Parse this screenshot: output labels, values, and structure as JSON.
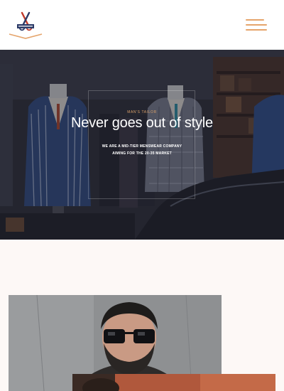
{
  "header": {
    "logo_icon": "scissors-tailor-logo",
    "menu_icon": "hamburger-menu-icon",
    "accent_color": "#e5a46b"
  },
  "hero": {
    "eyebrow": "MAN'S TAILOR",
    "title": "Never goes out of style",
    "subtitle_line1": "WE ARE A MID-TIER MENSWEAR COMPANY",
    "subtitle_line2": "AIMING FOR THE 20-35 MARKET",
    "eyebrow_color": "#d9a06a"
  },
  "content": {
    "background_color": "#fdf8f6",
    "portrait_subject": "man-with-sunglasses-photo",
    "secondary_image": "bearded-man-photo"
  }
}
